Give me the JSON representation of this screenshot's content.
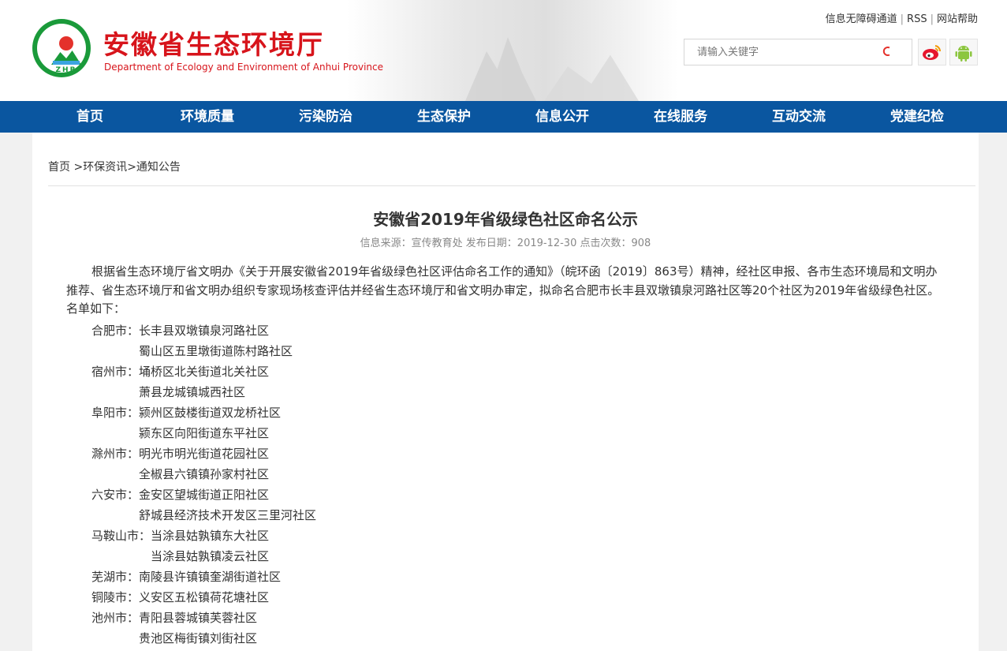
{
  "header": {
    "title": "安徽省生态环境厅",
    "subtitle": "Department of Ecology and Environment of Anhui Province",
    "logo_text": "ZHB",
    "top_links": [
      "信息无障碍通道",
      "RSS",
      "网站帮助"
    ],
    "separator": "|",
    "search_placeholder": "请输入关键字",
    "colors": {
      "brand_red": "#d7141b",
      "nav_blue": "#0a56a0",
      "logo_green": "#1a9a3a",
      "weibo_red": "#e6162d",
      "android_green": "#8cc63f"
    }
  },
  "nav": {
    "items": [
      "首页",
      "环境质量",
      "污染防治",
      "生态保护",
      "信息公开",
      "在线服务",
      "互动交流",
      "党建纪检"
    ]
  },
  "breadcrumb": {
    "home": "首页",
    "sep": " >",
    "level2": "环保资讯",
    "sep2": ">",
    "level3": "通知公告"
  },
  "article": {
    "title": "安徽省2019年省级绿色社区命名公示",
    "meta": "信息来源：宣传教育处 发布日期：2019-12-30 点击次数：908",
    "paragraph": "根据省生态环境厅省文明办《关于开展安徽省2019年省级绿色社区评估命名工作的通知》（皖环函〔2019〕863号）精神，经社区申报、各市生态环境局和文明办推荐、省生态环境厅和省文明办组织专家现场核查评估并经省生态环境厅和省文明办审定，拟命名合肥市长丰县双墩镇泉河路社区等20个社区为2019年省级绿色社区。名单如下：",
    "list": [
      {
        "city": "合肥市：",
        "community": "长丰县双墩镇泉河路社区"
      },
      {
        "city": "",
        "community": "蜀山区五里墩街道陈村路社区"
      },
      {
        "city": "宿州市：",
        "community": "埇桥区北关街道北关社区"
      },
      {
        "city": "",
        "community": "萧县龙城镇城西社区"
      },
      {
        "city": "阜阳市：",
        "community": "颍州区鼓楼街道双龙桥社区"
      },
      {
        "city": "",
        "community": "颍东区向阳街道东平社区"
      },
      {
        "city": "滁州市：",
        "community": "明光市明光街道花园社区"
      },
      {
        "city": "",
        "community": "全椒县六镇镇孙家村社区"
      },
      {
        "city": "六安市：",
        "community": "金安区望城街道正阳社区"
      },
      {
        "city": "",
        "community": "舒城县经济技术开发区三里河社区"
      },
      {
        "city": "马鞍山市：",
        "community": "当涂县姑孰镇东大社区"
      },
      {
        "city": "",
        "community": "当涂县姑孰镇凌云社区"
      },
      {
        "city": "芜湖市：",
        "community": "南陵县许镇镇奎湖街道社区"
      },
      {
        "city": "铜陵市：",
        "community": "义安区五松镇荷花塘社区"
      },
      {
        "city": "池州市：",
        "community": "青阳县蓉城镇芙蓉社区"
      },
      {
        "city": "",
        "community": "贵池区梅街镇刘街社区"
      }
    ]
  }
}
